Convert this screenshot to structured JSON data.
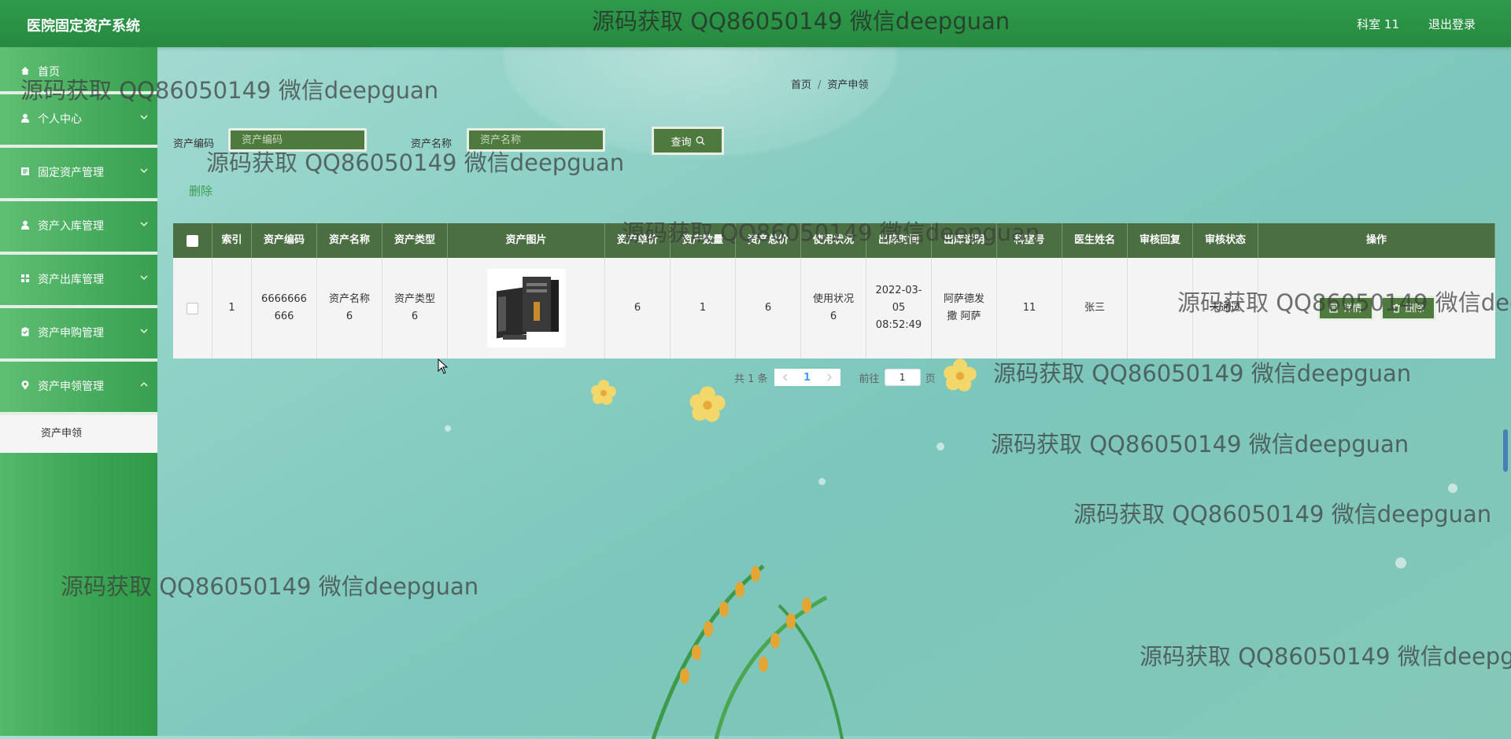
{
  "header": {
    "title": "医院固定资产系统",
    "user": "科室 11",
    "logout": "退出登录"
  },
  "sidebar": {
    "home": "首页",
    "items": [
      {
        "label": "个人中心",
        "icon": "user-icon"
      },
      {
        "label": "固定资产管理",
        "icon": "document-icon"
      },
      {
        "label": "资产入库管理",
        "icon": "user-icon"
      },
      {
        "label": "资产出库管理",
        "icon": "grid-icon"
      },
      {
        "label": "资产申购管理",
        "icon": "clipboard-icon"
      },
      {
        "label": "资产申领管理",
        "icon": "location-icon"
      }
    ],
    "submenu": "资产申领"
  },
  "breadcrumb": {
    "home": "首页",
    "sep": "/",
    "current": "资产申领"
  },
  "search": {
    "code_label": "资产编码",
    "code_placeholder": "资产编码",
    "name_label": "资产名称",
    "name_placeholder": "资产名称",
    "button": "查询"
  },
  "actions": {
    "delete": "删除"
  },
  "table": {
    "headers": [
      "索引",
      "资产编码",
      "资产名称",
      "资产类型",
      "资产图片",
      "资产单价",
      "资产数量",
      "资产总价",
      "使用状况",
      "出库时间",
      "出库说明",
      "科室号",
      "医生姓名",
      "审核回复",
      "审核状态",
      "操作"
    ],
    "rows": [
      {
        "index": "1",
        "code": "6666666666",
        "name": "资产名称6",
        "type": "资产类型6",
        "price": "6",
        "qty": "1",
        "total": "6",
        "usage": "使用状况6",
        "time": "2022-03-05 08:52:49",
        "desc": "阿萨德发撒 阿萨",
        "dept": "11",
        "doctor": "张三",
        "reply": "",
        "status": "未通过",
        "detail_btn": "详情",
        "delete_btn": "删除"
      }
    ]
  },
  "pagination": {
    "total": "共 1 条",
    "current": "1",
    "goto": "前往",
    "page_input": "1",
    "page_suffix": "页"
  },
  "watermark": "源码获取 QQ86050149 微信deepguan",
  "colors": {
    "header": "#2e9a4a",
    "accent": "#4e7a3e",
    "table_header": "#4b6f42",
    "link": "#3a9d52"
  }
}
